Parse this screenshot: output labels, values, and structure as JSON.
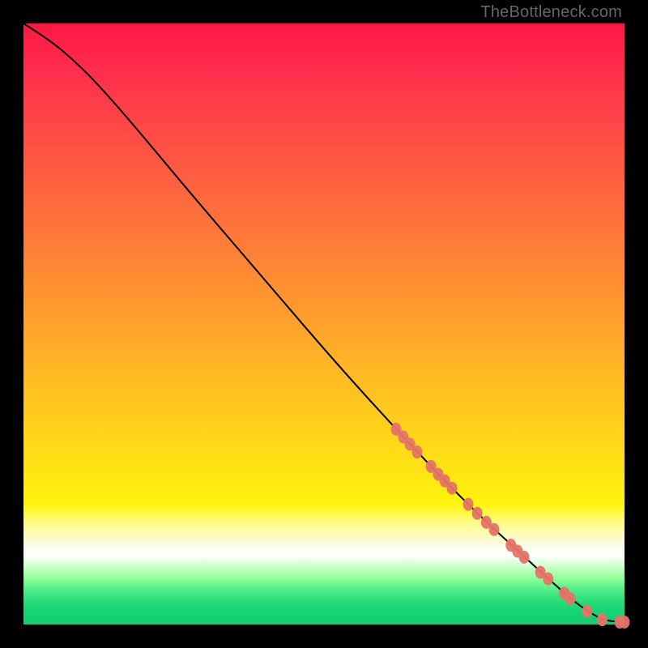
{
  "watermark": "TheBottleneck.com",
  "chart_data": {
    "type": "line",
    "title": "",
    "xlabel": "",
    "ylabel": "",
    "xlim": [
      0,
      100
    ],
    "ylim": [
      0,
      100
    ],
    "grid": false,
    "series": [
      {
        "name": "curve",
        "style": "line",
        "color": "#000000",
        "points": [
          {
            "x": 0,
            "y": 100
          },
          {
            "x": 4,
            "y": 97.5
          },
          {
            "x": 8,
            "y": 94.2
          },
          {
            "x": 12,
            "y": 90.3
          },
          {
            "x": 18,
            "y": 83.5
          },
          {
            "x": 28,
            "y": 71.5
          },
          {
            "x": 40,
            "y": 57.5
          },
          {
            "x": 52,
            "y": 43.5
          },
          {
            "x": 62,
            "y": 32.5
          },
          {
            "x": 70,
            "y": 24.0
          },
          {
            "x": 76,
            "y": 18.0
          },
          {
            "x": 82,
            "y": 12.5
          },
          {
            "x": 88,
            "y": 7.0
          },
          {
            "x": 92,
            "y": 3.5
          },
          {
            "x": 95,
            "y": 1.5
          },
          {
            "x": 97,
            "y": 0.6
          },
          {
            "x": 100,
            "y": 0.4
          }
        ]
      },
      {
        "name": "markers",
        "style": "scatter",
        "color": "#e67366",
        "points": [
          {
            "x": 62.0,
            "y": 32.5
          },
          {
            "x": 63.2,
            "y": 31.2
          },
          {
            "x": 64.3,
            "y": 30.0
          },
          {
            "x": 65.5,
            "y": 28.7
          },
          {
            "x": 67.8,
            "y": 26.3
          },
          {
            "x": 69.0,
            "y": 25.0
          },
          {
            "x": 70.1,
            "y": 23.9
          },
          {
            "x": 71.3,
            "y": 22.7
          },
          {
            "x": 74.0,
            "y": 20.0
          },
          {
            "x": 75.5,
            "y": 18.5
          },
          {
            "x": 77.0,
            "y": 17.0
          },
          {
            "x": 78.3,
            "y": 15.8
          },
          {
            "x": 81.1,
            "y": 13.2
          },
          {
            "x": 82.2,
            "y": 12.2
          },
          {
            "x": 83.3,
            "y": 11.2
          },
          {
            "x": 86.0,
            "y": 8.7
          },
          {
            "x": 87.3,
            "y": 7.6
          },
          {
            "x": 90.0,
            "y": 5.2
          },
          {
            "x": 91.0,
            "y": 4.3
          },
          {
            "x": 93.8,
            "y": 2.2
          },
          {
            "x": 96.3,
            "y": 0.8
          },
          {
            "x": 99.2,
            "y": 0.4
          },
          {
            "x": 100.0,
            "y": 0.4
          }
        ]
      }
    ]
  }
}
